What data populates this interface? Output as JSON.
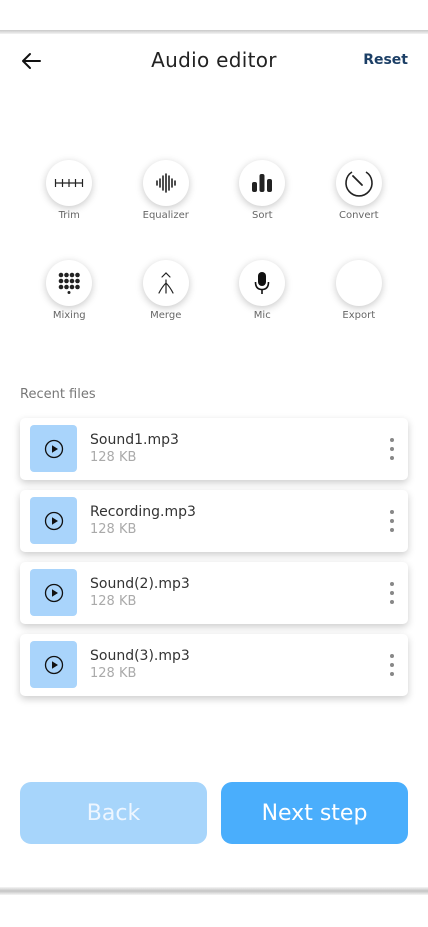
{
  "header": {
    "title": "Audio editor",
    "reset_label": "Reset"
  },
  "tools": [
    {
      "label": "Trim",
      "icon": "trim-icon"
    },
    {
      "label": "Equalizer",
      "icon": "equalizer-icon"
    },
    {
      "label": "Sort",
      "icon": "sort-icon"
    },
    {
      "label": "Convert",
      "icon": "convert-icon"
    },
    {
      "label": "Mixing",
      "icon": "mixing-icon"
    },
    {
      "label": "Merge",
      "icon": "merge-icon"
    },
    {
      "label": "Mic",
      "icon": "mic-icon"
    },
    {
      "label": "Export",
      "icon": "export-icon"
    }
  ],
  "recent": {
    "label": "Recent files",
    "files": [
      {
        "name": "Sound1.mp3",
        "size": "128 KB"
      },
      {
        "name": "Recording.mp3",
        "size": "128 KB"
      },
      {
        "name": "Sound(2).mp3",
        "size": "128 KB"
      },
      {
        "name": "Sound(3).mp3",
        "size": "128 KB"
      }
    ]
  },
  "footer": {
    "back_label": "Back",
    "next_label": "Next step"
  },
  "colors": {
    "accent": "#4aaefc",
    "accent_light": "#a7d5fb",
    "thumb": "#a9d4fb",
    "reset": "#1c3f66"
  }
}
